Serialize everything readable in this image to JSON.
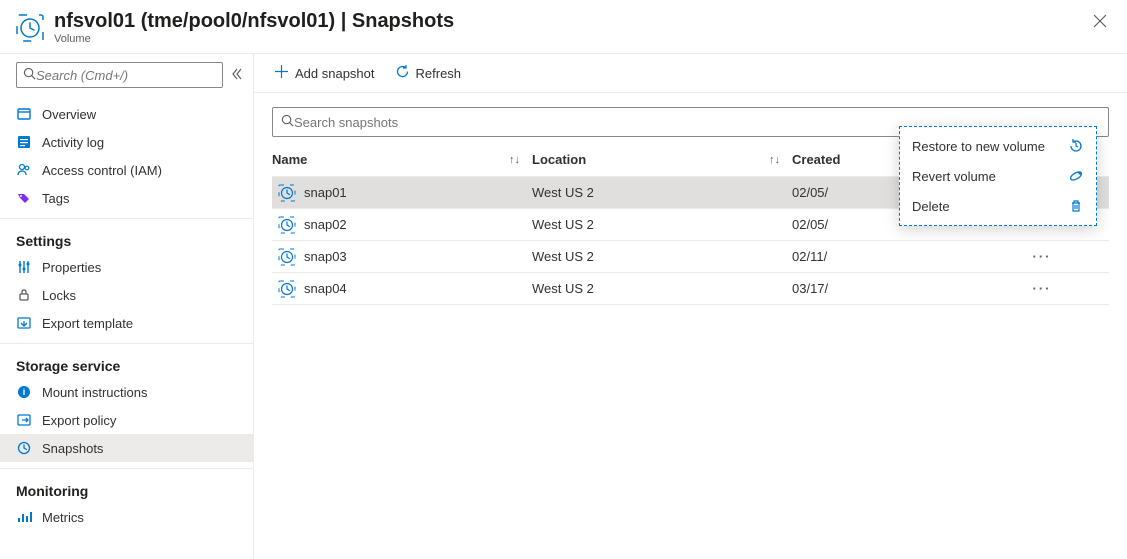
{
  "header": {
    "title": "nfsvol01 (tme/pool0/nfsvol01) | Snapshots",
    "subtitle": "Volume"
  },
  "sidebar": {
    "search_placeholder": "Search (Cmd+/)",
    "groups": [
      {
        "heading": null,
        "items": [
          {
            "id": "overview",
            "label": "Overview",
            "icon": "overview-icon"
          },
          {
            "id": "activity-log",
            "label": "Activity log",
            "icon": "activity-log-icon"
          },
          {
            "id": "iam",
            "label": "Access control (IAM)",
            "icon": "iam-icon"
          },
          {
            "id": "tags",
            "label": "Tags",
            "icon": "tags-icon"
          }
        ]
      },
      {
        "heading": "Settings",
        "items": [
          {
            "id": "properties",
            "label": "Properties",
            "icon": "properties-icon"
          },
          {
            "id": "locks",
            "label": "Locks",
            "icon": "locks-icon"
          },
          {
            "id": "export-template",
            "label": "Export template",
            "icon": "export-template-icon"
          }
        ]
      },
      {
        "heading": "Storage service",
        "items": [
          {
            "id": "mount",
            "label": "Mount instructions",
            "icon": "mount-icon"
          },
          {
            "id": "export-policy",
            "label": "Export policy",
            "icon": "export-policy-icon"
          },
          {
            "id": "snapshots",
            "label": "Snapshots",
            "icon": "snapshots-icon",
            "active": true
          }
        ]
      },
      {
        "heading": "Monitoring",
        "items": [
          {
            "id": "metrics",
            "label": "Metrics",
            "icon": "metrics-icon"
          }
        ]
      }
    ]
  },
  "toolbar": {
    "add_label": "Add snapshot",
    "refresh_label": "Refresh"
  },
  "grid": {
    "search_placeholder": "Search snapshots",
    "columns": {
      "name": "Name",
      "location": "Location",
      "created": "Created"
    },
    "rows": [
      {
        "name": "snap01",
        "location": "West US 2",
        "created": "02/05/",
        "selected": true
      },
      {
        "name": "snap02",
        "location": "West US 2",
        "created": "02/05/"
      },
      {
        "name": "snap03",
        "location": "West US 2",
        "created": "02/11/"
      },
      {
        "name": "snap04",
        "location": "West US 2",
        "created": "03/17/"
      }
    ]
  },
  "context_menu": {
    "items": [
      {
        "id": "restore",
        "label": "Restore to new volume",
        "icon": "restore-icon"
      },
      {
        "id": "revert",
        "label": "Revert volume",
        "icon": "revert-icon"
      },
      {
        "id": "delete",
        "label": "Delete",
        "icon": "delete-icon"
      }
    ]
  }
}
